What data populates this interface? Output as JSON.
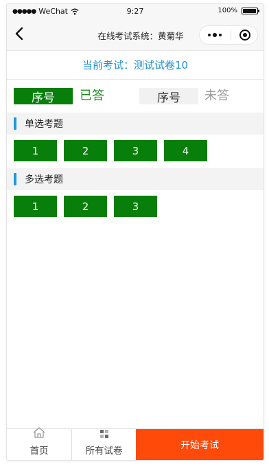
{
  "status_bar": {
    "carrier": "WeChat",
    "signal_dots": "●●●●●",
    "time": "9:27",
    "battery": "100%"
  },
  "nav": {
    "title": "在线考试系统：黄菊华",
    "back_icon": "chevron-left-icon",
    "more_icon": "more-dots-icon",
    "close_icon": "target-circle-icon"
  },
  "current_exam": {
    "label": "当前考试：测试试卷10"
  },
  "legend": {
    "answered_box": "序号",
    "answered_label": "已答",
    "unanswered_box": "序号",
    "unanswered_label": "未答"
  },
  "sections": {
    "single": {
      "title": "单选考题",
      "questions": [
        "1",
        "2",
        "3",
        "4"
      ]
    },
    "multi": {
      "title": "多选考题",
      "questions": [
        "1",
        "2",
        "3"
      ]
    }
  },
  "tabs": {
    "home": "首页",
    "all_papers": "所有试卷",
    "start_exam": "开始考试"
  },
  "colors": {
    "answered": "#087f0a",
    "accent_blue": "#1f8fd1",
    "start_button": "#ff4a0a"
  }
}
